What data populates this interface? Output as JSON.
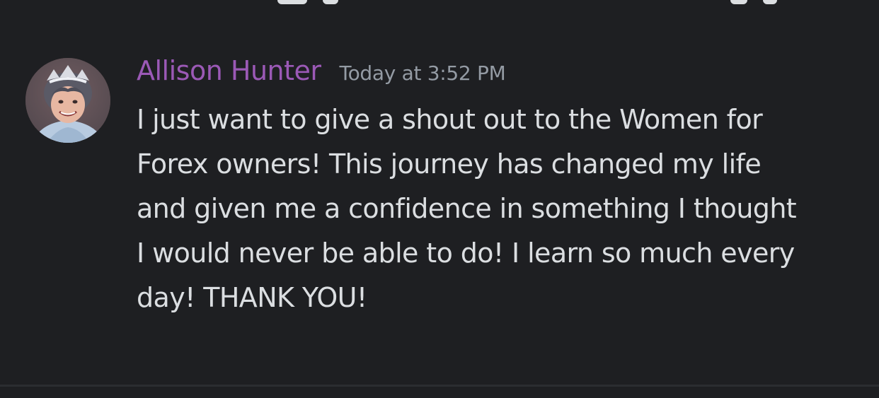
{
  "message": {
    "author": "Allison Hunter",
    "timestamp": "Today at 3:52 PM",
    "lines": [
      "I just want to give a shout out to the Women for",
      "Forex owners!  This journey has changed my life",
      "and given me a confidence in something I thought",
      "I would never be able to do!  I learn so much every",
      "day!  THANK YOU!"
    ],
    "colors": {
      "author": "#9b59b6",
      "timestamp": "#949ba4",
      "text": "#dbdee1",
      "background": "#1e1f22"
    }
  }
}
